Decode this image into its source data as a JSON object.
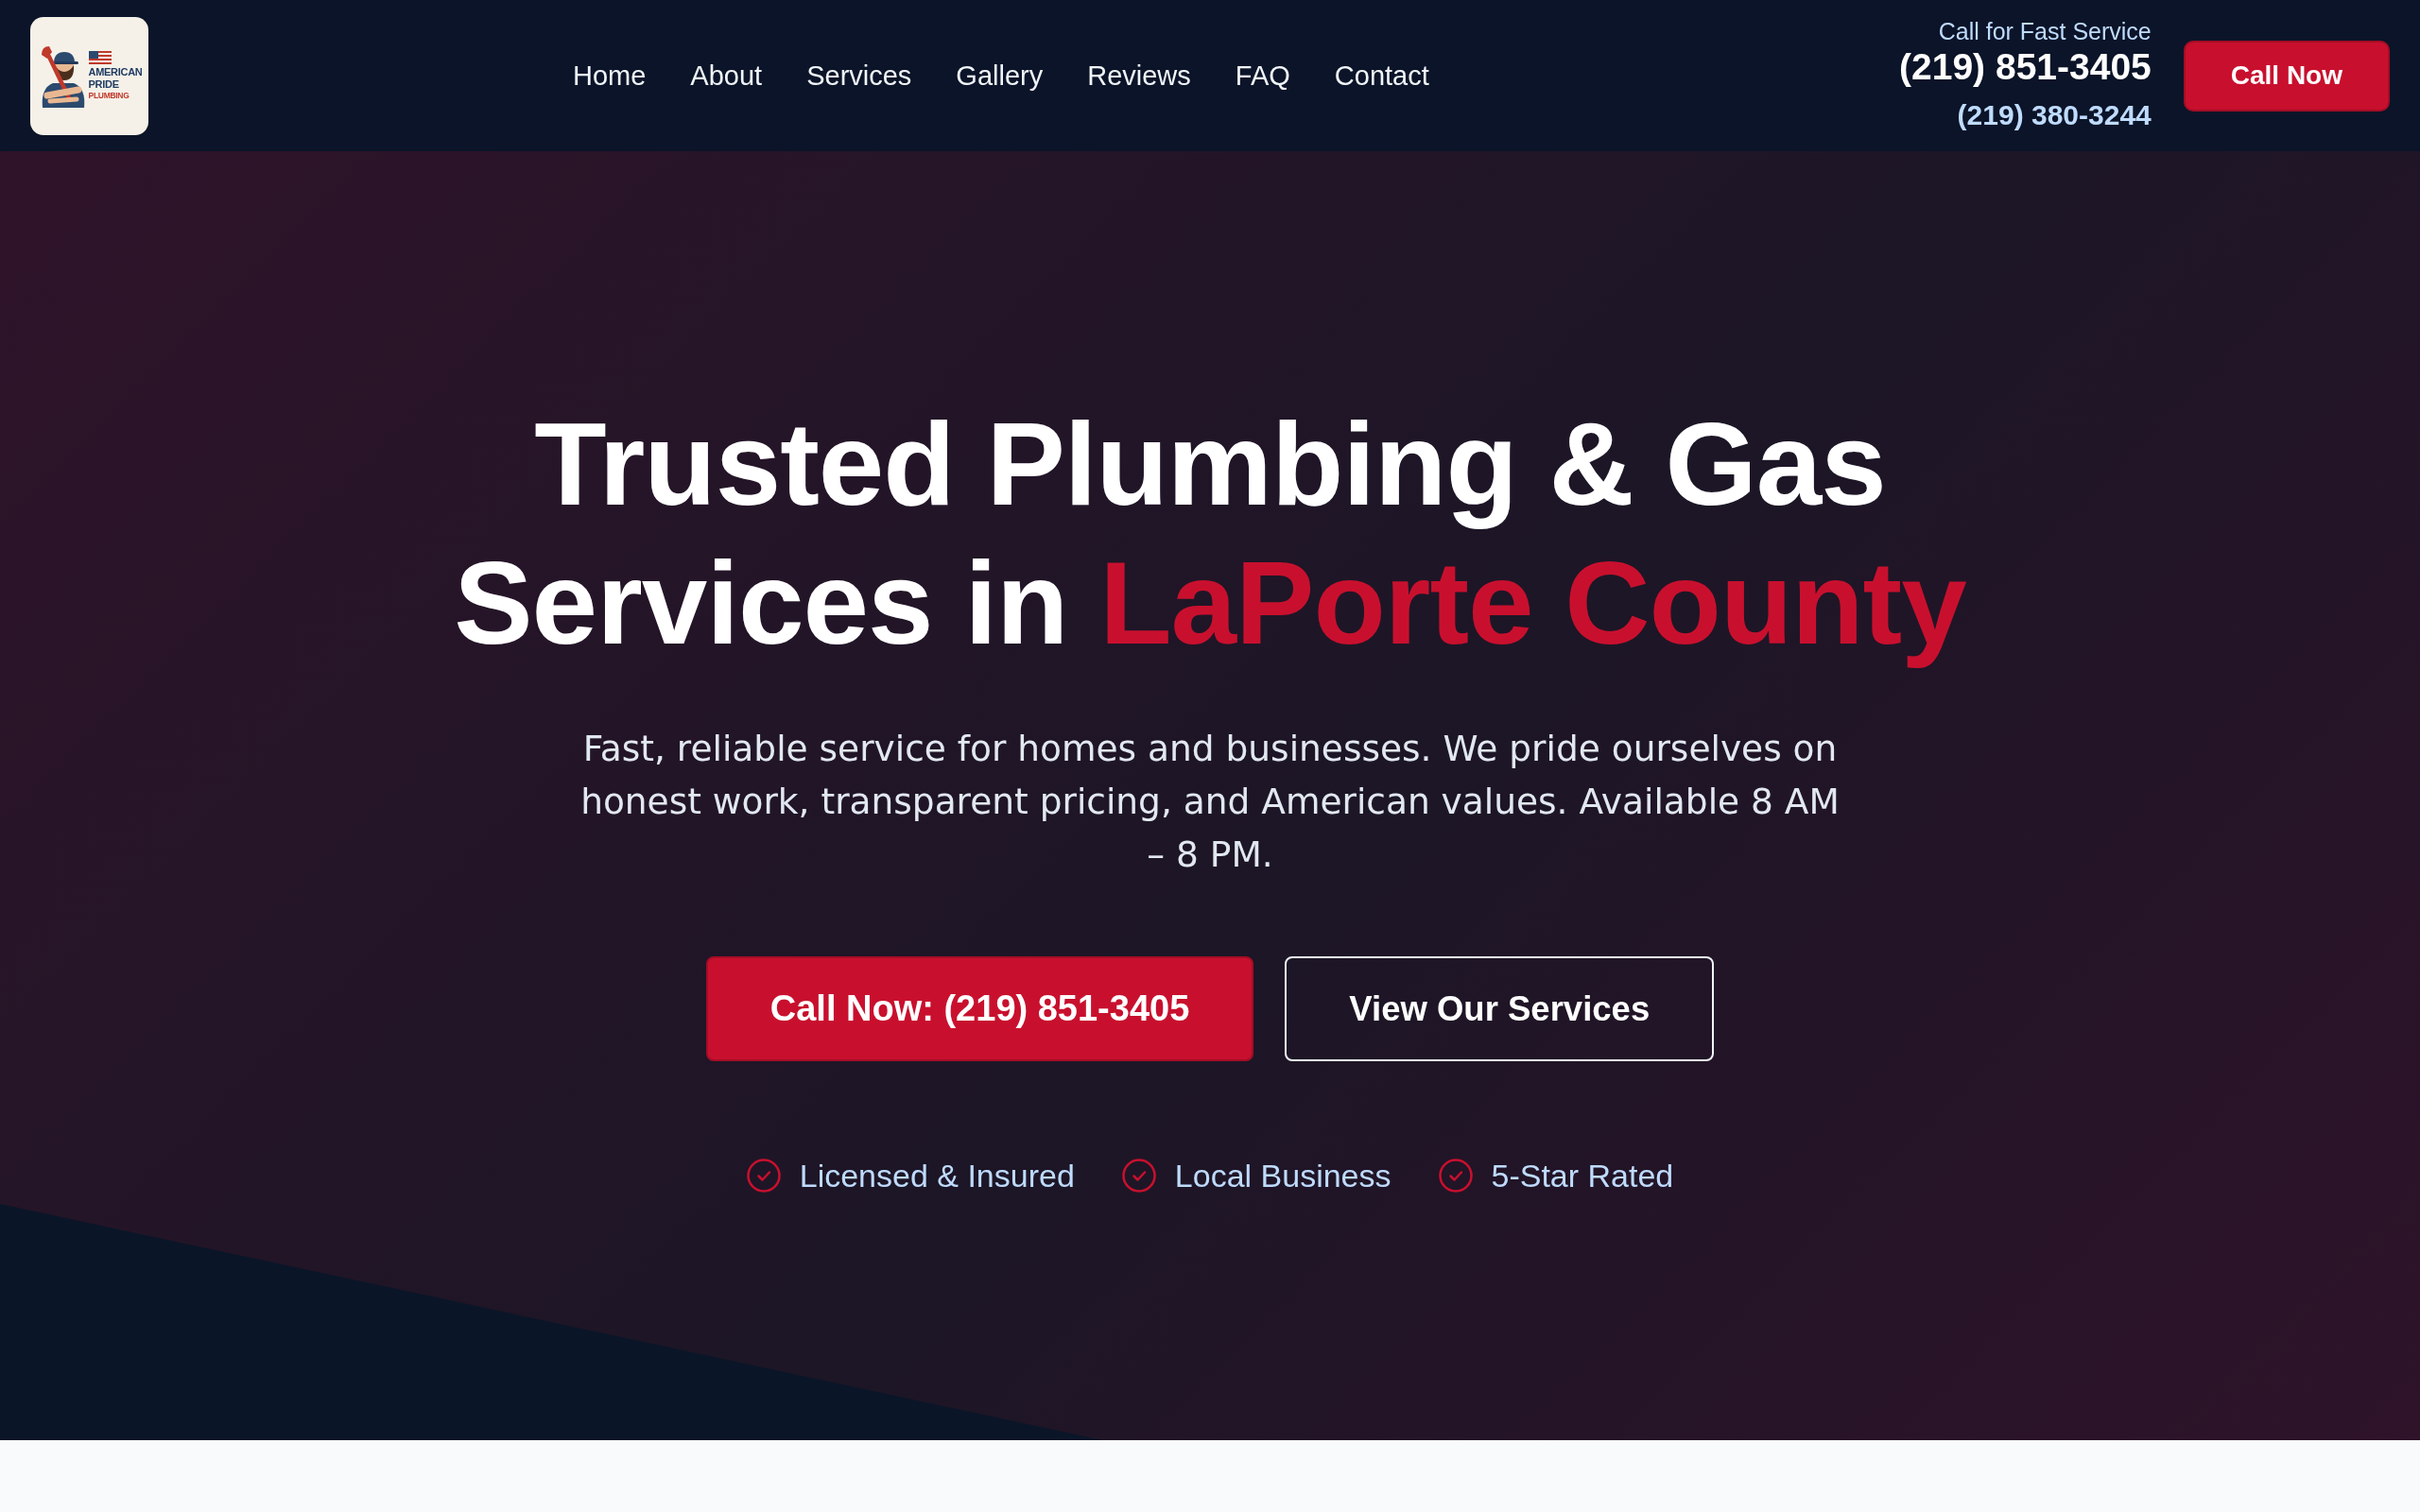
{
  "header": {
    "logo": {
      "lines": [
        {
          "text": "AMERICAN",
          "color": "#1f3b63"
        },
        {
          "text": "PRIDE",
          "color": "#1f3b63"
        },
        {
          "text": "PLUMBING",
          "color": "#c0392b"
        }
      ]
    },
    "nav": [
      "Home",
      "About",
      "Services",
      "Gallery",
      "Reviews",
      "FAQ",
      "Contact"
    ],
    "contact": {
      "label": "Call for Fast Service",
      "primary_phone": "(219) 851-3405",
      "secondary_phone": "(219) 380-3244"
    },
    "cta_button": "Call Now"
  },
  "hero": {
    "headline": "Trusted Plumbing & Gas Services in",
    "headline_highlight": "LaPorte County",
    "subtitle": "Fast, reliable service for homes and businesses. We pride ourselves on honest work, transparent pricing, and American values. Available 8 AM – 8 PM.",
    "buttons": [
      {
        "label": "Call Now: (219) 851-3405",
        "kind": "primary"
      },
      {
        "label": "View Our Services",
        "kind": "outline"
      }
    ],
    "features": [
      "Licensed & Insured",
      "Local Business",
      "5-Star Rated"
    ]
  }
}
